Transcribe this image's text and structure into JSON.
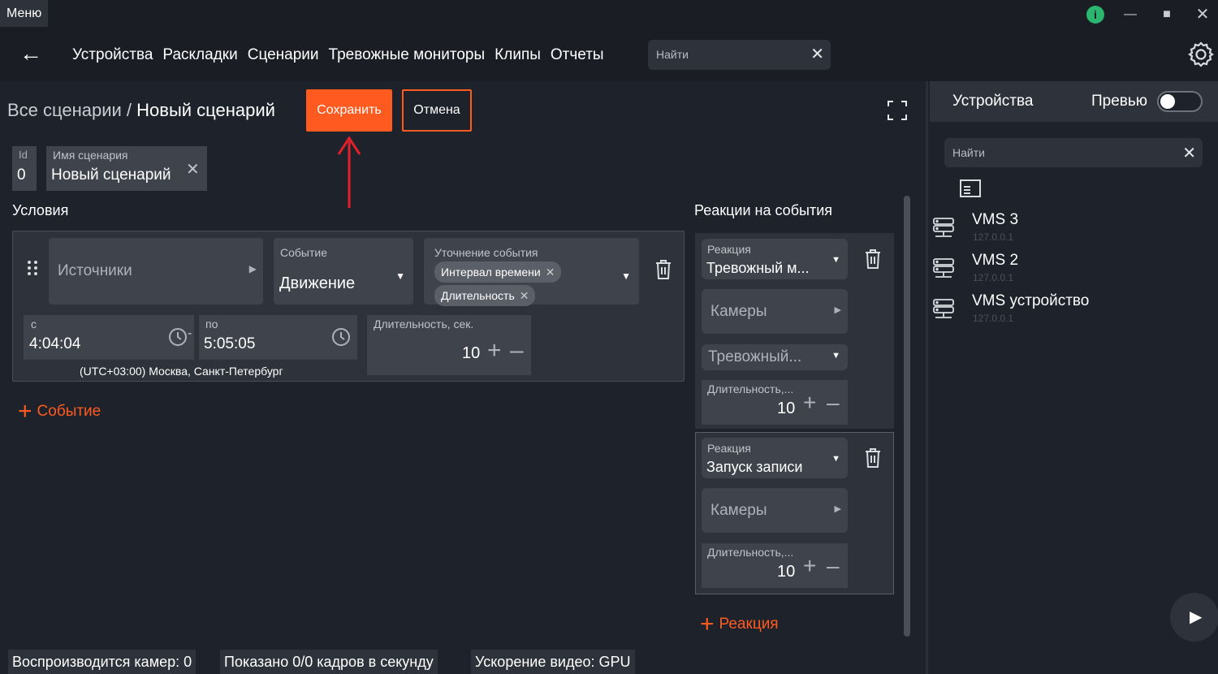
{
  "titlebar": {
    "menu_label": "Меню",
    "info_glyph": "i"
  },
  "nav": {
    "tabs": [
      "Устройства",
      "Раскладки",
      "Сценарии",
      "Тревожные мониторы",
      "Клипы",
      "Отчеты"
    ],
    "search_placeholder": "Найти"
  },
  "header": {
    "breadcrumb_parent": "Все сценарии / ",
    "breadcrumb_current": "Новый сценарий",
    "save_label": "Сохранить",
    "cancel_label": "Отмена"
  },
  "scenario": {
    "id_label": "Id",
    "id_value": "0",
    "name_label": "Имя сценария",
    "name_value": "Новый сценарий"
  },
  "conditions": {
    "title": "Условия",
    "sources_label": "Источники",
    "event_label": "Событие",
    "event_value": "Движение",
    "refine_label": "Уточнение события",
    "refine_chips": [
      "Интервал времени",
      "Длительность"
    ],
    "from_label": "с",
    "from_value": "4:04:04",
    "to_label": "по",
    "to_value": "5:05:05",
    "separator": "-",
    "timezone": "(UTC+03:00) Москва, Санкт-Петербург",
    "duration_label": "Длительность, сек.",
    "duration_value": "10",
    "add_event_label": "Событие"
  },
  "reactions": {
    "title": "Реакции на события",
    "items": [
      {
        "label": "Реакция",
        "value": "Тревожный м...",
        "cameras_label": "Камеры",
        "alarm_label": "Тревожный...",
        "duration_label": "Длительность,...",
        "duration_value": "10"
      },
      {
        "label": "Реакция",
        "value": "Запуск записи",
        "cameras_label": "Камеры",
        "duration_label": "Длительность,...",
        "duration_value": "10"
      }
    ],
    "add_reaction_label": "Реакция"
  },
  "right_panel": {
    "title": "Устройства",
    "preview_label": "Превью",
    "preview_on": false,
    "search_placeholder": "Найти",
    "devices": [
      {
        "name": "VMS 3",
        "ip": "127.0.0.1"
      },
      {
        "name": "VMS 2",
        "ip": "127.0.0.1"
      },
      {
        "name": "VMS устройство",
        "ip": "127.0.0.1"
      }
    ]
  },
  "status_bar": {
    "cameras": "Воспроизводится камер: 0",
    "fps": "Показано 0/0 кадров в секунду",
    "acceleration": "Ускорение видео: GPU"
  },
  "colors": {
    "accent": "#ff5a1f",
    "background": "#1e222b",
    "panel": "#2e323b",
    "field": "#3f434c",
    "info_badge": "#2bb56e",
    "annotation_arrow": "#e0202a"
  }
}
